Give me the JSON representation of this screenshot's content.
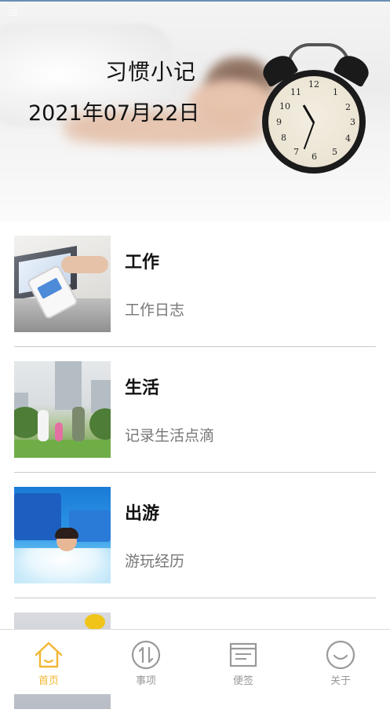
{
  "status": {
    "text": "运"
  },
  "hero": {
    "title": "习惯小记",
    "date": "2021年07月22日"
  },
  "clock": {
    "numbers": [
      "12",
      "1",
      "2",
      "3",
      "4",
      "5",
      "6",
      "7",
      "8",
      "9",
      "10",
      "11"
    ]
  },
  "items": [
    {
      "name": "工作",
      "sub": "工作日志",
      "image": "work-photo"
    },
    {
      "name": "生活",
      "sub": "记录生活点滴",
      "image": "family-walk-photo"
    },
    {
      "name": "出游",
      "sub": "游玩经历",
      "image": "water-park-photo"
    },
    {
      "name": "",
      "sub": "",
      "image": "partial-photo"
    }
  ],
  "tabs": [
    {
      "label": "首页",
      "icon": "home-icon",
      "active": true
    },
    {
      "label": "事项",
      "icon": "swap-arrows-icon",
      "active": false
    },
    {
      "label": "便签",
      "icon": "notepad-icon",
      "active": false
    },
    {
      "label": "关于",
      "icon": "smile-icon",
      "active": false
    }
  ],
  "colors": {
    "accent": "#f2b632",
    "inactive": "#999999",
    "divider": "#c9c9c9"
  }
}
